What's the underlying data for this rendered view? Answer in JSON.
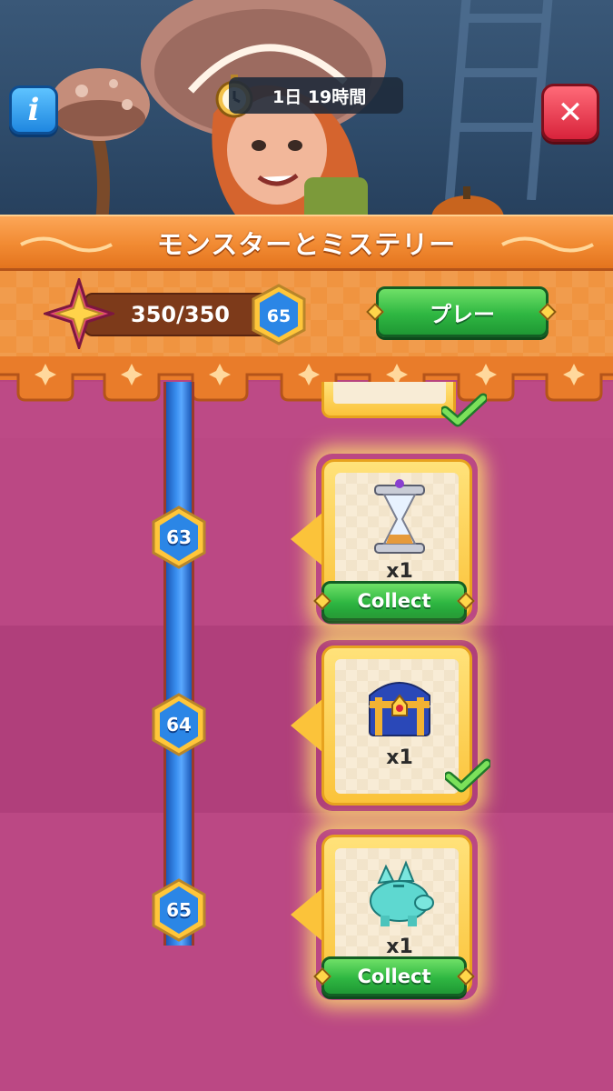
{
  "event": {
    "timer": "1日 19時間",
    "title": "モンスターとミステリー",
    "progress": "350/350",
    "level": "65",
    "play_label": "プレー"
  },
  "rewards": [
    {
      "level": "63",
      "item": "hourglass-icon",
      "quantity": "x1",
      "state": "collectable",
      "button_label": "Collect"
    },
    {
      "level": "64",
      "item": "treasure-chest-icon",
      "quantity": "x1",
      "state": "claimed"
    },
    {
      "level": "65",
      "item": "crystal-piggy-bank-icon",
      "quantity": "x1",
      "state": "collectable",
      "button_label": "Collect"
    }
  ],
  "colors": {
    "accent_orange": "#f18a32",
    "track_blue": "#3a8ff0",
    "button_green": "#2fb742",
    "background_magenta": "#b8457f",
    "card_gold": "#fbc33a"
  }
}
